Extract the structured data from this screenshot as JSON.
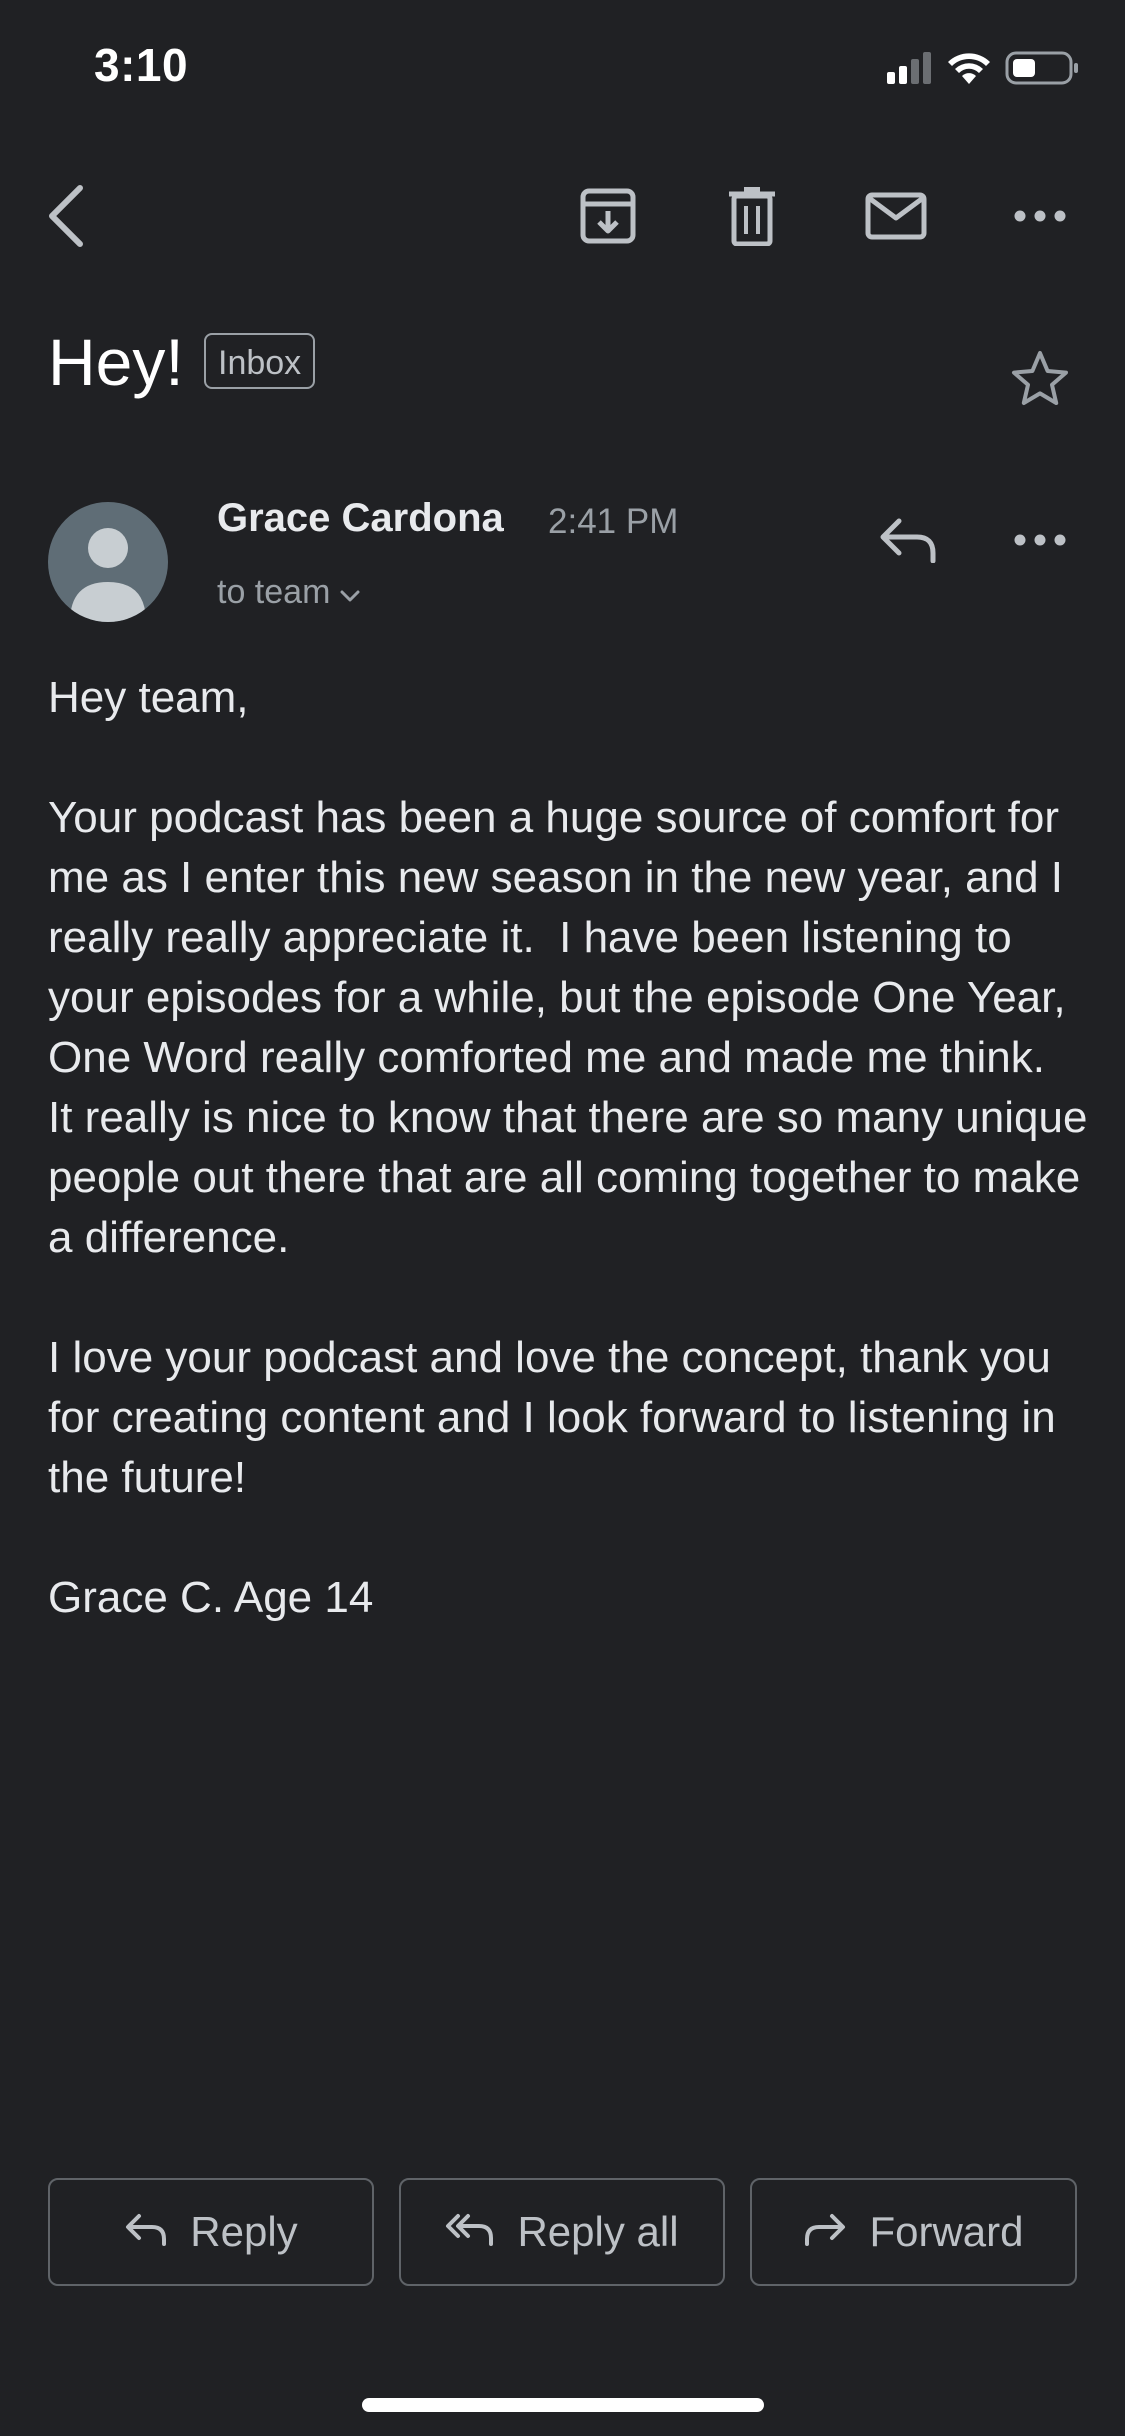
{
  "status_bar": {
    "time": "3:10",
    "icons": [
      "cellular-signal-icon",
      "wifi-icon",
      "battery-icon"
    ]
  },
  "toolbar": {
    "icons": [
      "back-arrow-icon",
      "archive-icon",
      "trash-icon",
      "mark-unread-icon",
      "more-options-icon"
    ]
  },
  "email": {
    "subject": "Hey!",
    "label": "Inbox",
    "sender_name": "Grace Cardona",
    "time": "2:41 PM",
    "recipients": "to team",
    "body": [
      "Hey team,",
      "Your podcast has been a huge source of comfort for me as I enter this new season in the new year, and I really really appreciate it.  I have been listening to your episodes for a while, but the episode One Year, One Word really comforted me and made me think.  It really is nice to know that there are so many unique people out there that are all coming together to make a difference.",
      "I love your podcast and love the concept, thank you for creating content and I look forward to listening in the future!",
      "Grace C. Age 14"
    ]
  },
  "actions": {
    "reply": "Reply",
    "reply_all": "Reply all",
    "forward": "Forward"
  },
  "colors": {
    "background": "#202124",
    "text": "#e8eaed",
    "muted": "#9aa0a6",
    "border": "#5f6368"
  }
}
